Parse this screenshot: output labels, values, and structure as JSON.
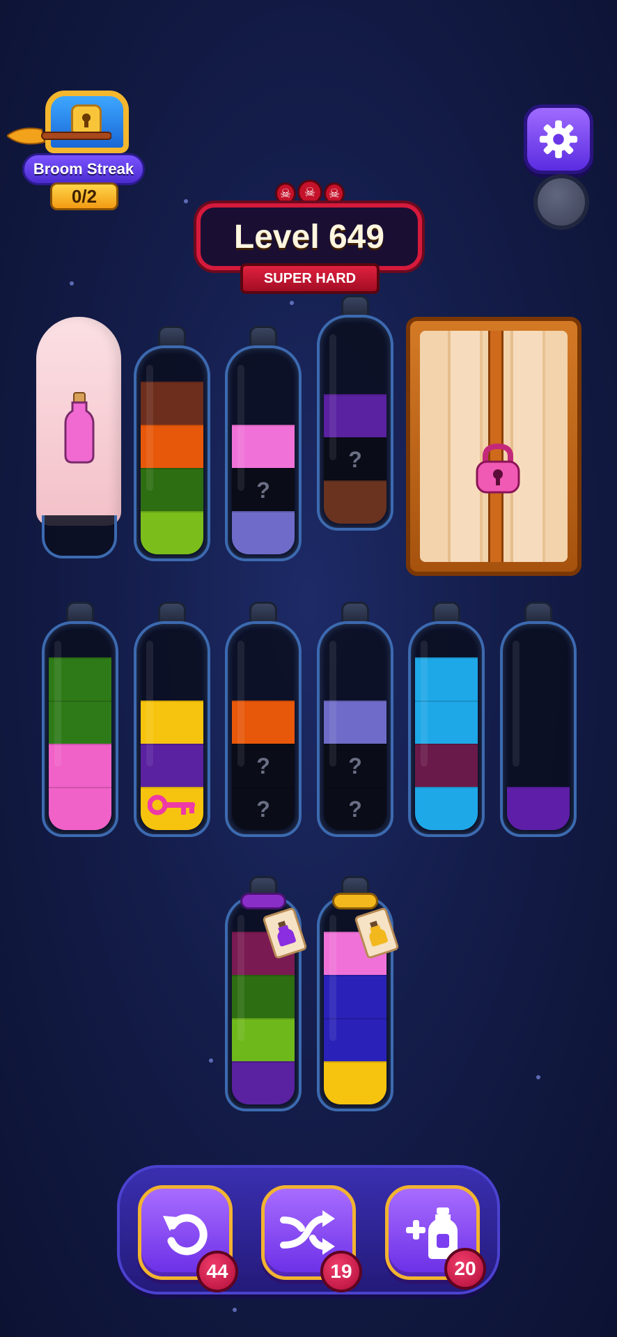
{
  "streak": {
    "label": "Broom Streak",
    "count": "0/2"
  },
  "level": {
    "title": "Level 649",
    "difficulty": "SUPER HARD"
  },
  "icons": {
    "settings": "gear-icon",
    "undo": "undo-icon",
    "shuffle": "shuffle-icon",
    "add_bottle": "add-bottle-icon"
  },
  "bottles_row1": [
    {
      "id": "ghost",
      "state": "covered"
    },
    {
      "id": "b2",
      "layers": [
        "#7bbe1c",
        "#2e6e12",
        "#e8580a",
        "#6e2e1e"
      ]
    },
    {
      "id": "b3",
      "layers": [
        "#6e6cc8",
        "hidden",
        "#f072d8"
      ]
    },
    {
      "id": "b4",
      "layers": [
        "#6a3320",
        "hidden",
        "#5a21a0"
      ]
    },
    {
      "id": "crate",
      "state": "locked"
    }
  ],
  "bottles_row2": [
    {
      "id": "b6",
      "layers": [
        "#f062c8",
        "#f062c8",
        "#2e7a18",
        "#2e7a18"
      ]
    },
    {
      "id": "b7",
      "layers": [
        "#f6c40e",
        "#5a21a0",
        "#f6c40e"
      ],
      "key": true
    },
    {
      "id": "b8",
      "layers": [
        "hidden",
        "hidden",
        "#e8580a"
      ]
    },
    {
      "id": "b9",
      "layers": [
        "hidden",
        "hidden",
        "#6e6cc8"
      ]
    },
    {
      "id": "b10",
      "layers": [
        "#1ea8e8",
        "#6a1a4a",
        "#1ea8e8",
        "#1ea8e8"
      ]
    },
    {
      "id": "b11",
      "layers": [
        "#5e1ea8"
      ]
    }
  ],
  "bottles_row3": [
    {
      "id": "b12",
      "layers": [
        "#5a21a0",
        "#6eb81c",
        "#2e6e12",
        "#7a1a52"
      ],
      "rope": "#8a2ec8"
    },
    {
      "id": "b13",
      "layers": [
        "#f6c40e",
        "#2a22b8",
        "#2a22b8",
        "#f072d8"
      ],
      "rope": "#f2b81e"
    }
  ],
  "hidden_mark": "?",
  "tools": [
    {
      "id": "undo",
      "count": "44"
    },
    {
      "id": "shuffle",
      "count": "19"
    },
    {
      "id": "add_bottle",
      "count": "20"
    }
  ]
}
